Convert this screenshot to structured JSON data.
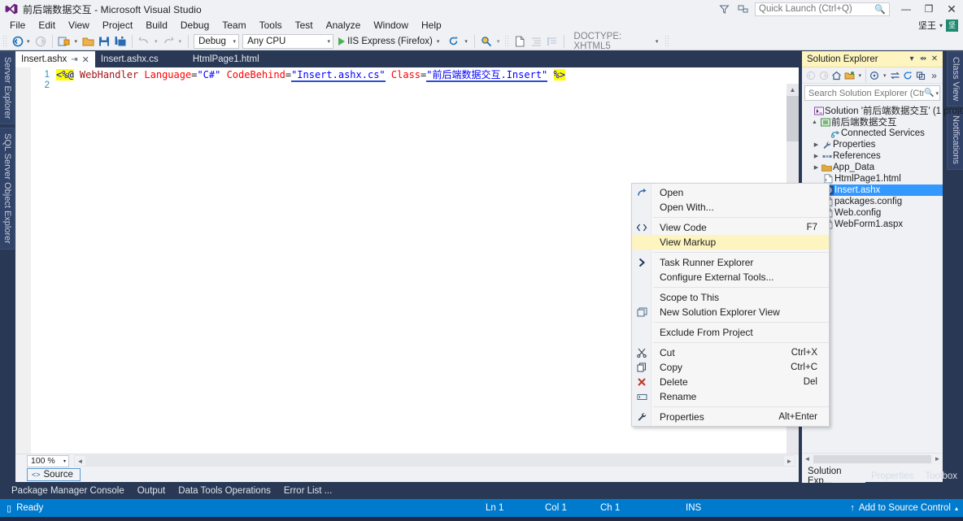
{
  "window": {
    "title": "前后端数据交互 - Microsoft Visual Studio",
    "logo_icon": "vs-logo-icon",
    "minimize_label": "—",
    "restore_label": "❐",
    "close_label": "✕",
    "feedback_icon": "feedback-funnel-icon",
    "screenshot_icon": "send-feedback-icon"
  },
  "quick_launch": {
    "placeholder": "Quick Launch (Ctrl+Q)",
    "value": "",
    "icon": "search-icon"
  },
  "account": {
    "name": "坚王",
    "caret": "▾",
    "avatar_text": "坚"
  },
  "menubar": {
    "items": [
      {
        "label": "File"
      },
      {
        "label": "Edit"
      },
      {
        "label": "View"
      },
      {
        "label": "Project"
      },
      {
        "label": "Build"
      },
      {
        "label": "Debug"
      },
      {
        "label": "Team"
      },
      {
        "label": "Tools"
      },
      {
        "label": "Test"
      },
      {
        "label": "Analyze"
      },
      {
        "label": "Window"
      },
      {
        "label": "Help"
      }
    ]
  },
  "toolbar": {
    "nav_back_icon": "navigate-back-icon",
    "nav_forward_icon": "navigate-forward-icon",
    "new_project_icon": "new-project-icon",
    "open_file_icon": "open-file-icon",
    "save_icon": "save-icon",
    "save_all_icon": "save-all-icon",
    "undo_icon": "undo-icon",
    "redo_icon": "redo-icon",
    "config_combo": "Debug",
    "platform_combo": "Any CPU",
    "run_label": "IIS Express (Firefox)",
    "run_icon": "play-icon",
    "refresh_icon": "refresh-icon",
    "find_icon": "find-in-files-icon",
    "newfile_icon": "new-file-icon",
    "indent_icon": "format-indent-icon",
    "comment_icon": "comment-icon",
    "doctype_combo": "DOCTYPE: XHTML5",
    "caret": "▾"
  },
  "left_tabs": [
    {
      "label": "Server Explorer"
    },
    {
      "label": "SQL Server Object Explorer"
    }
  ],
  "right_tabs": [
    {
      "label": "Class View"
    },
    {
      "label": "Notifications"
    }
  ],
  "editor": {
    "tabs": [
      {
        "label": "Insert.ashx",
        "active": true,
        "pin": "⇥",
        "close": "✕"
      },
      {
        "label": "Insert.ashx.cs",
        "active": false
      },
      {
        "label": "HtmlPage1.html",
        "active": false
      }
    ],
    "lines": [
      {
        "num": "1",
        "segments": [
          {
            "text": "<%@",
            "type": "directive"
          },
          {
            "text": " ",
            "type": "plain"
          },
          {
            "text": "WebHandler",
            "type": "tag"
          },
          {
            "text": " ",
            "type": "plain"
          },
          {
            "text": "Language",
            "type": "attr"
          },
          {
            "text": "=",
            "type": "eq"
          },
          {
            "text": "\"C#\"",
            "type": "value"
          },
          {
            "text": " ",
            "type": "plain"
          },
          {
            "text": "CodeBehind",
            "type": "attr"
          },
          {
            "text": "=",
            "type": "eq"
          },
          {
            "text": "\"Insert.ashx.cs\"",
            "type": "value-squiggle"
          },
          {
            "text": " ",
            "type": "plain"
          },
          {
            "text": "Class",
            "type": "attr"
          },
          {
            "text": "=",
            "type": "eq"
          },
          {
            "text": "\"前后端数据交互.Insert\"",
            "type": "value-squiggle"
          },
          {
            "text": " ",
            "type": "plain"
          },
          {
            "text": "%>",
            "type": "directive"
          }
        ]
      },
      {
        "num": "2",
        "segments": []
      }
    ],
    "zoom": "100 %",
    "zoom_caret": "▾",
    "view_mode": "Source",
    "view_mode_icon": "source-view-icon",
    "scroll_up": "▲",
    "scroll_down": "▼",
    "hscroll_left": "◄",
    "hscroll_right": "►"
  },
  "context_menu": {
    "items": [
      {
        "label": "Open",
        "shortcut": "",
        "icon": "open-arrow-icon",
        "highlight": false,
        "separator_after": false
      },
      {
        "label": "Open With...",
        "shortcut": "",
        "icon": "",
        "highlight": false,
        "separator_after": true
      },
      {
        "label": "View Code",
        "shortcut": "F7",
        "icon": "code-brackets-icon",
        "highlight": false,
        "separator_after": false
      },
      {
        "label": "View Markup",
        "shortcut": "",
        "icon": "",
        "highlight": true,
        "separator_after": true
      },
      {
        "label": "Task Runner Explorer",
        "shortcut": "",
        "icon": "chevron-right-icon",
        "highlight": false,
        "separator_after": false
      },
      {
        "label": "Configure External Tools...",
        "shortcut": "",
        "icon": "",
        "highlight": false,
        "separator_after": true
      },
      {
        "label": "Scope to This",
        "shortcut": "",
        "icon": "",
        "highlight": false,
        "separator_after": false
      },
      {
        "label": "New Solution Explorer View",
        "shortcut": "",
        "icon": "new-window-icon",
        "highlight": false,
        "separator_after": true
      },
      {
        "label": "Exclude From Project",
        "shortcut": "",
        "icon": "",
        "highlight": false,
        "separator_after": true
      },
      {
        "label": "Cut",
        "shortcut": "Ctrl+X",
        "icon": "scissors-icon",
        "highlight": false,
        "separator_after": false
      },
      {
        "label": "Copy",
        "shortcut": "Ctrl+C",
        "icon": "copy-icon",
        "highlight": false,
        "separator_after": false
      },
      {
        "label": "Delete",
        "shortcut": "Del",
        "icon": "delete-x-icon",
        "highlight": false,
        "separator_after": false
      },
      {
        "label": "Rename",
        "shortcut": "",
        "icon": "rename-icon",
        "highlight": false,
        "separator_after": true
      },
      {
        "label": "Properties",
        "shortcut": "Alt+Enter",
        "icon": "wrench-icon",
        "highlight": false,
        "separator_after": false
      }
    ]
  },
  "solution_explorer": {
    "title": "Solution Explorer",
    "caret_icon": "chevron-down-icon",
    "pin_icon": "pin-icon",
    "close_icon": "close-icon",
    "toolbar_icons": [
      "back-icon",
      "forward-icon",
      "home-icon",
      "pending-changes-icon",
      "sync-icon",
      "preview-icon",
      "refresh-icon",
      "collapse-all-icon",
      "properties-icon",
      "overflow-icon"
    ],
    "search_placeholder": "Search Solution Explorer (Ctrl+;)",
    "search_icon": "search-icon",
    "search_caret": "▾",
    "tree": [
      {
        "label": "Solution '前后端数据交互' (1 proje",
        "indent": 0,
        "twisty": "",
        "icon": "solution-icon",
        "selected": false
      },
      {
        "label": "前后端数据交互",
        "indent": 1,
        "twisty": "▲",
        "icon": "web-project-icon",
        "selected": false
      },
      {
        "label": "Connected Services",
        "indent": 2,
        "twisty": "",
        "icon": "connected-services-icon",
        "selected": false
      },
      {
        "label": "Properties",
        "indent": 2,
        "twisty": "▶",
        "icon": "wrench-icon",
        "selected": false
      },
      {
        "label": "References",
        "indent": 2,
        "twisty": "▶",
        "icon": "references-icon",
        "selected": false
      },
      {
        "label": "App_Data",
        "indent": 2,
        "twisty": "▶",
        "icon": "folder-icon",
        "selected": false
      },
      {
        "label": "HtmlPage1.html",
        "indent": 2,
        "twisty": "",
        "icon": "html-file-icon",
        "selected": false
      },
      {
        "label": "Insert.ashx",
        "indent": 2,
        "twisty": "",
        "icon": "handler-file-icon",
        "selected": true
      },
      {
        "label": "packages.config",
        "indent": 2,
        "twisty": "",
        "icon": "config-file-icon",
        "selected": false
      },
      {
        "label": "Web.config",
        "indent": 2,
        "twisty": "",
        "icon": "config-file-icon",
        "selected": false
      },
      {
        "label": "WebForm1.aspx",
        "indent": 2,
        "twisty": "",
        "icon": "aspx-file-icon",
        "selected": false
      }
    ],
    "bottom_tabs": [
      {
        "label": "Solution Exp...",
        "active": true
      },
      {
        "label": "Properties",
        "active": false
      },
      {
        "label": "Toolbox",
        "active": false
      }
    ],
    "hscroll_left": "◄",
    "hscroll_right": "►"
  },
  "bottom_dock": {
    "tabs": [
      {
        "label": "Package Manager Console"
      },
      {
        "label": "Output"
      },
      {
        "label": "Data Tools Operations"
      },
      {
        "label": "Error List ..."
      }
    ]
  },
  "statusbar": {
    "ready": "Ready",
    "ready_icon": "status-icon",
    "line": "Ln 1",
    "col": "Col 1",
    "ch": "Ch 1",
    "ins": "INS",
    "source_control": "Add to Source Control",
    "source_control_icon": "upload-arrow-icon",
    "source_control_caret": "▴"
  },
  "colors": {
    "accent_blue": "#007acc",
    "chrome": "#293955",
    "panel": "#eff1f5",
    "selection": "#3399ff",
    "highlight_yellow": "#fdf4bf"
  }
}
